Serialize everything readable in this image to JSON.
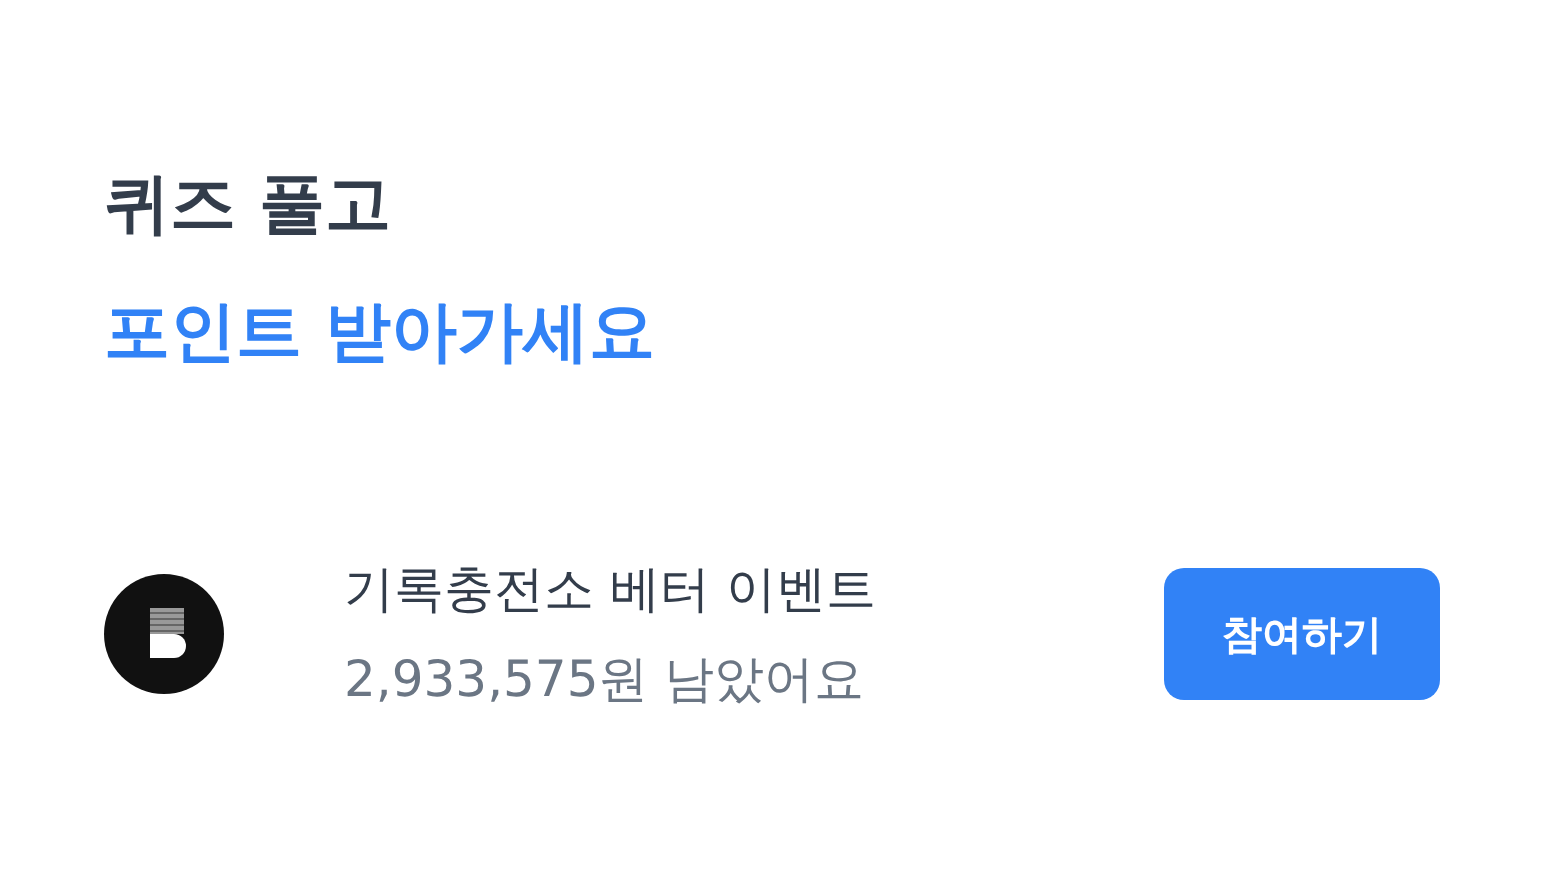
{
  "heading": {
    "line_1": "퀴즈 풀고",
    "line_2": "포인트 받아가세요"
  },
  "event": {
    "title": "기록충전소 베터 이벤트",
    "subtitle": "2,933,575원 남았어요",
    "button": "참여하기"
  }
}
